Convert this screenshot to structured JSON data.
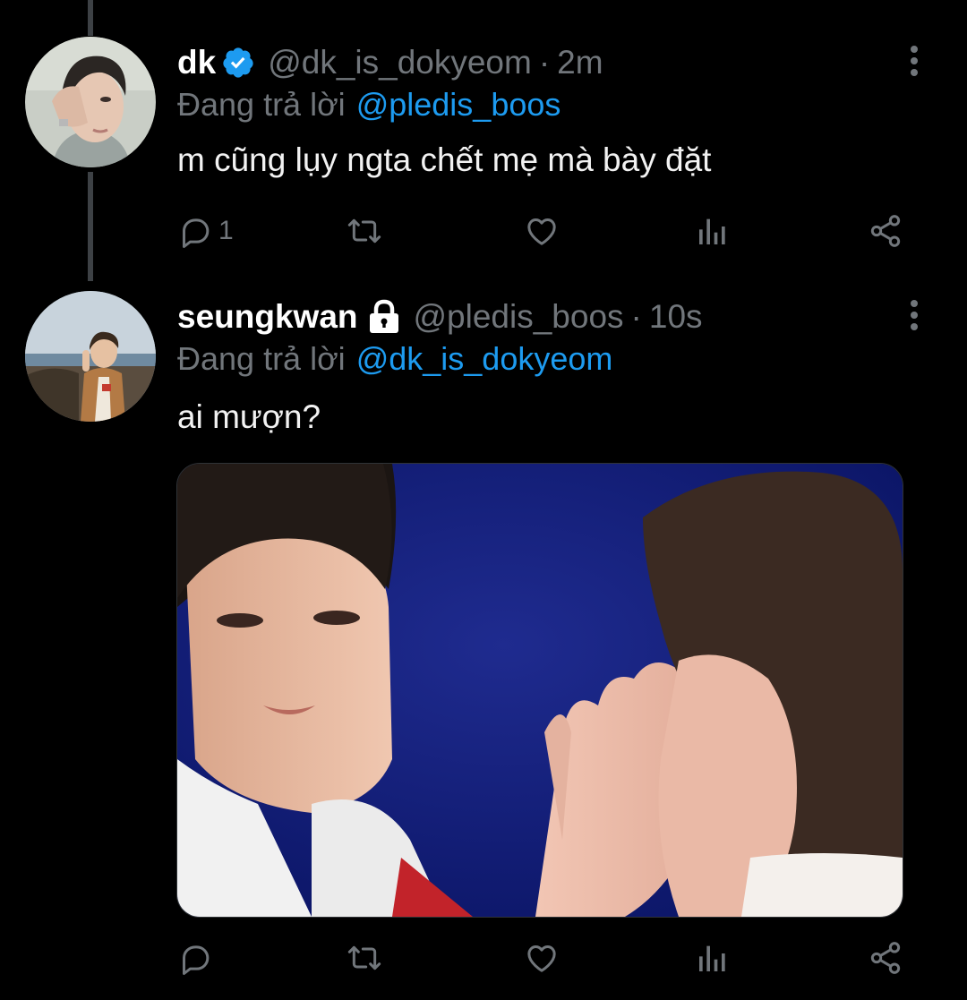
{
  "colors": {
    "background": "#000000",
    "accent": "#1d9bf0",
    "secondary_text": "#71767b",
    "thread_line": "#3d4145"
  },
  "tweets": [
    {
      "display_name": "dk",
      "badge": "verified-icon",
      "handle": "@dk_is_dokyeom",
      "separator": "·",
      "time": "2m",
      "reply_prefix": "Đang trả lời",
      "reply_to": "@pledis_boos",
      "text": "m cũng lụy ngta chết mẹ mà bày đặt",
      "actions": {
        "reply_count": "1",
        "retweet_count": "",
        "like_count": ""
      }
    },
    {
      "display_name": "seungkwan",
      "badge": "lock-icon",
      "handle": "@pledis_boos",
      "separator": "·",
      "time": "10s",
      "reply_prefix": "Đang trả lời",
      "reply_to": "@dk_is_dokyeom",
      "text": "ai mượn?",
      "media": "photo",
      "actions": {
        "reply_count": "",
        "retweet_count": "",
        "like_count": ""
      }
    }
  ]
}
